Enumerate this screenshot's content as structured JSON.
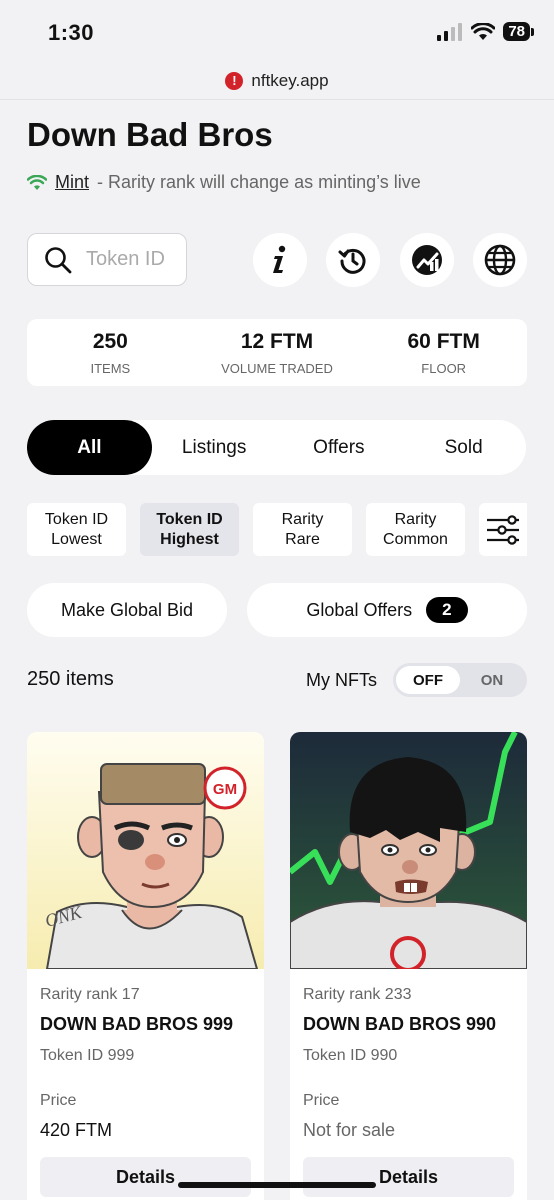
{
  "status_bar": {
    "time": "1:30",
    "battery": "78"
  },
  "browser": {
    "url": "nftkey.app"
  },
  "header": {
    "title": "Down Bad Bros",
    "mint_link": "Mint",
    "mint_note": "- Rarity rank will change as minting’s live"
  },
  "search": {
    "placeholder": "Token ID"
  },
  "icon_buttons": [
    "info-icon",
    "history-icon",
    "chart-icon",
    "globe-icon"
  ],
  "stats": [
    {
      "value": "250",
      "label": "ITEMS"
    },
    {
      "value": "12 FTM",
      "label": "VOLUME TRADED"
    },
    {
      "value": "60 FTM",
      "label": "FLOOR"
    }
  ],
  "tabs": [
    "All",
    "Listings",
    "Offers",
    "Sold"
  ],
  "active_tab": "All",
  "sort": [
    {
      "line1": "Token ID",
      "line2": "Lowest"
    },
    {
      "line1": "Token ID",
      "line2": "Highest"
    },
    {
      "line1": "Rarity",
      "line2": "Rare"
    },
    {
      "line1": "Rarity",
      "line2": "Common"
    }
  ],
  "active_sort": "Token ID Highest",
  "actions": {
    "make_global_bid": "Make Global Bid",
    "global_offers": "Global Offers",
    "global_offers_count": "2"
  },
  "listing": {
    "count_text": "250 items",
    "my_nfts_label": "My NFTs",
    "toggle_off": "OFF",
    "toggle_on": "ON",
    "toggle_state": "OFF"
  },
  "cards": [
    {
      "rarity": "Rarity rank 17",
      "name": "DOWN BAD BROS 999",
      "token_id": "Token ID 999",
      "price_label": "Price",
      "price": "420 FTM",
      "details": "Details"
    },
    {
      "rarity": "Rarity rank 233",
      "name": "DOWN BAD BROS 990",
      "token_id": "Token ID 990",
      "price_label": "Price",
      "price": "Not for sale",
      "details": "Details"
    }
  ],
  "card_art": {
    "speech_bubble": "GM",
    "tattoo": "ONK"
  },
  "colors": {
    "accent": "#000000",
    "mint_wifi": "#3aa757",
    "warn": "#d2232a"
  }
}
